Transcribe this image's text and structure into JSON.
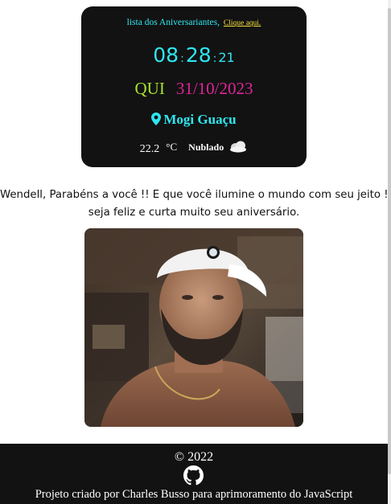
{
  "header_card": {
    "list_text": "lista dos Aniversariantes,",
    "list_link": "Clique aqui.",
    "clock": {
      "hours": "08",
      "sep1": ":",
      "minutes": "28",
      "sep2": ":",
      "seconds": "21"
    },
    "weekday": "QUI",
    "date": "31/10/2023",
    "city": "Mogi Guaçu",
    "temperature": "22.2",
    "temperature_unit": "°C",
    "condition": "Nublado",
    "icons": {
      "location": "map-pin-icon",
      "weather": "cloud-icon"
    },
    "colors": {
      "background": "#121212",
      "clock": "#2ee6f0",
      "weekday": "#a6e22e",
      "date": "#e0249a",
      "link": "#f6e23c"
    }
  },
  "message": {
    "line1": "Wendell, Parabéns a você !! E que você ilumine o mundo com seu jeito !",
    "line2": "seja feliz e curta muito seu aniversário."
  },
  "photo": {
    "subject": "man-wearing-white-cap-photo"
  },
  "footer": {
    "copyright": "© 2022",
    "icon": "github-icon",
    "credit": "Projeto criado por Charles Busso para aprimoramento do JavaScript"
  }
}
